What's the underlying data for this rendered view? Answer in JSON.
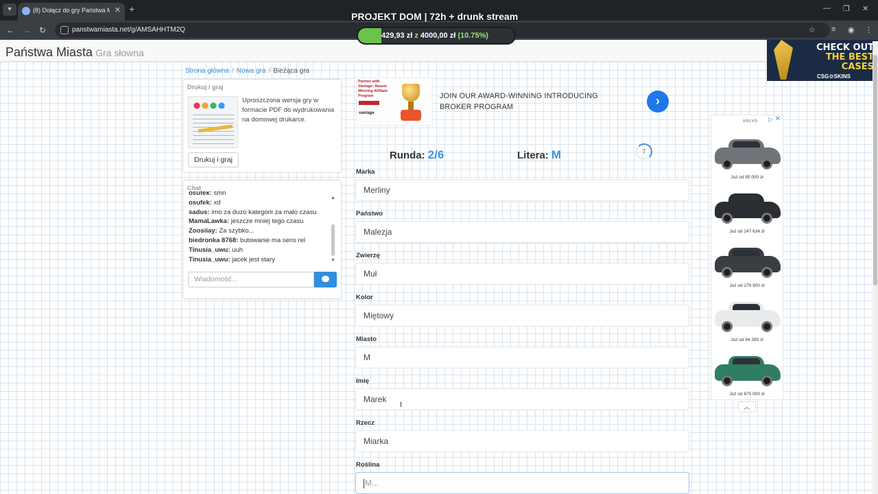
{
  "browser": {
    "tab_title": "(8) Dołącz do gry Państwa Miast",
    "url": "panstwamiasta.net/g/AMSAHHTM2Q"
  },
  "stream": {
    "title": "PROJEKT DOM | 72h + drunk stream",
    "goal_current": "429,93 zł",
    "goal_connector": "z",
    "goal_target": "4000,00 zł",
    "goal_percent_label": "(10.75%)",
    "goal_fraction": 0.1075
  },
  "promo": {
    "line1": "CHECK OUT",
    "line2": "THE BEST",
    "line3": "CASES",
    "brand": "CSG⚙SKINS"
  },
  "site": {
    "title": "Państwa Miasta",
    "subtitle": "Gra słowna"
  },
  "breadcrumb": {
    "home": "Strona główna",
    "new_game": "Nowa gra",
    "current": "Bieżąca gra"
  },
  "print_panel": {
    "heading": "Drukuj i graj",
    "description": "Uproszczona wersja gry w formacie PDF do wydrukowania na domowej drukarce.",
    "button": "Drukuj i graj"
  },
  "chat": {
    "heading": "Chat",
    "messages": [
      {
        "user": "osufek:",
        "text": "smh"
      },
      {
        "user": "osufek:",
        "text": "xd"
      },
      {
        "user": "sadus:",
        "text": "imo za duzo kategorii za malo czasu"
      },
      {
        "user": "MamaLawka:",
        "text": "jeszcze mniej tego czasu"
      },
      {
        "user": "Zoosiiay:",
        "text": "Za szybko..."
      },
      {
        "user": "biedronka 8768:",
        "text": "butowanie ma sens rel"
      },
      {
        "user": "Tinusia_uwu:",
        "text": "uuh"
      },
      {
        "user": "Tinusia_uwu:",
        "text": "jacek jest stary"
      }
    ],
    "input_placeholder": "Wiadomość..."
  },
  "ad_banner": {
    "small_text": "Partner with Vantage: Award-Winning Affiliate Program",
    "logo": "vantage",
    "copy": "JOIN OUR AWARD-WINNING INTRODUCING BROKER PROGRAM"
  },
  "game": {
    "round_label": "Runda:",
    "round_value": "2/6",
    "letter_label": "Litera:",
    "letter_value": "M",
    "timer": "7",
    "fields": [
      {
        "label": "Marka",
        "value": "Merliny"
      },
      {
        "label": "Państwo",
        "value": "Malezja"
      },
      {
        "label": "Zwierzę",
        "value": "Muł"
      },
      {
        "label": "Kolor",
        "value": "Miętowy"
      },
      {
        "label": "Miasto",
        "value": "M"
      },
      {
        "label": "Imię",
        "value": "Marek"
      },
      {
        "label": "Rzecz",
        "value": "Miarka"
      },
      {
        "label": "Roślina",
        "value": "",
        "placeholder": "M..."
      }
    ]
  },
  "car_ad": {
    "brand": "VOLVO",
    "prices": [
      "Już od 95 000 zł",
      "Już od 147 634 zł",
      "Już od 279 900 zł",
      "Już od 94 285 zł",
      "Już od 675 000 zł"
    ],
    "colors": [
      "#6f7478",
      "#2a2d31",
      "#3a3d42",
      "#e9eaec",
      "#2f7d62"
    ]
  }
}
